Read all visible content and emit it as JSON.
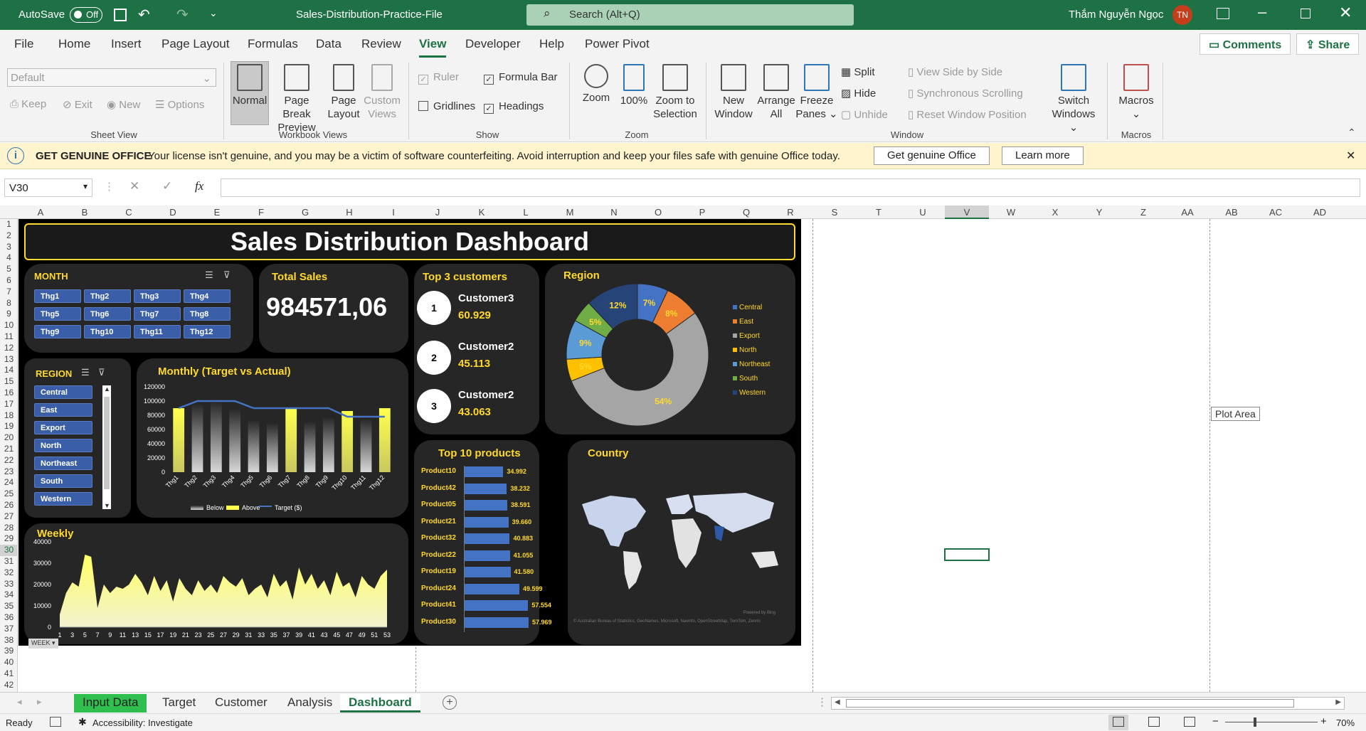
{
  "titlebar": {
    "autosave_label": "AutoSave",
    "autosave_state": "Off",
    "filename": "Sales-Distribution-Practice-File",
    "search_placeholder": "Search (Alt+Q)",
    "user_name": "Thắm Nguyễn Ngọc",
    "user_initials": "TN"
  },
  "ribbon_tabs": [
    "File",
    "Home",
    "Insert",
    "Page Layout",
    "Formulas",
    "Data",
    "Review",
    "View",
    "Developer",
    "Help",
    "Power Pivot"
  ],
  "active_tab": "View",
  "right_buttons": {
    "comments": "Comments",
    "share": "Share"
  },
  "ribbon": {
    "sheet_view": {
      "dropdown": "Default",
      "keep": "Keep",
      "exit": "Exit",
      "new": "New",
      "options": "Options",
      "label": "Sheet View"
    },
    "workbook_views": {
      "normal": "Normal",
      "page_break": "Page Break",
      "page_break2": "Preview",
      "page_layout": "Page",
      "page_layout2": "Layout",
      "custom": "Custom",
      "custom2": "Views",
      "label": "Workbook Views"
    },
    "show": {
      "ruler": "Ruler",
      "formula_bar": "Formula Bar",
      "gridlines": "Gridlines",
      "headings": "Headings",
      "label": "Show"
    },
    "zoom": {
      "zoom": "Zoom",
      "hundred": "100%",
      "zoom_sel": "Zoom to",
      "zoom_sel2": "Selection",
      "label": "Zoom"
    },
    "window": {
      "new_window": "New",
      "new_window2": "Window",
      "arrange": "Arrange",
      "arrange2": "All",
      "freeze": "Freeze",
      "freeze2": "Panes",
      "split": "Split",
      "hide": "Hide",
      "unhide": "Unhide",
      "side": "View Side by Side",
      "sync": "Synchronous Scrolling",
      "reset": "Reset Window Position",
      "switch": "Switch",
      "switch2": "Windows",
      "label": "Window"
    },
    "macros": {
      "macros": "Macros",
      "label": "Macros"
    }
  },
  "message_bar": {
    "title": "GET GENUINE OFFICE",
    "text": "Your license isn't genuine, and you may be a victim of software counterfeiting. Avoid interruption and keep your files safe with genuine Office today.",
    "btn1": "Get genuine Office",
    "btn2": "Learn more"
  },
  "formula_bar": {
    "namebox": "V30",
    "fx": "fx",
    "value": ""
  },
  "columns": [
    "A",
    "B",
    "C",
    "D",
    "E",
    "F",
    "G",
    "H",
    "I",
    "J",
    "K",
    "L",
    "M",
    "N",
    "O",
    "P",
    "Q",
    "R",
    "S",
    "T",
    "U",
    "V",
    "W",
    "X",
    "Y",
    "Z",
    "AA",
    "AB",
    "AC",
    "AD"
  ],
  "rows": [
    "1",
    "2",
    "3",
    "4",
    "5",
    "6",
    "7",
    "8",
    "9",
    "10",
    "11",
    "12",
    "13",
    "14",
    "15",
    "16",
    "17",
    "18",
    "19",
    "20",
    "21",
    "22",
    "23",
    "24",
    "25",
    "26",
    "27",
    "28",
    "29",
    "30",
    "31",
    "32",
    "33",
    "34",
    "35",
    "36",
    "37",
    "38",
    "39",
    "40",
    "41",
    "42"
  ],
  "dashboard": {
    "title": "Sales Distribution Dashboard",
    "month_slicer": {
      "title": "MONTH",
      "items": [
        "Thg1",
        "Thg2",
        "Thg3",
        "Thg4",
        "Thg5",
        "Thg6",
        "Thg7",
        "Thg8",
        "Thg9",
        "Thg10",
        "Thg11",
        "Thg12"
      ]
    },
    "total_sales": {
      "title": "Total Sales",
      "value": "984571,06"
    },
    "top3": {
      "title": "Top 3 customers",
      "items": [
        {
          "rank": "1",
          "name": "Customer3",
          "value": "60.929"
        },
        {
          "rank": "2",
          "name": "Customer2",
          "value": "45.113"
        },
        {
          "rank": "3",
          "name": "Customer2",
          "value": "43.063"
        }
      ]
    },
    "region_slicer": {
      "title": "REGION",
      "items": [
        "Central",
        "East",
        "Export",
        "North",
        "Northeast",
        "South",
        "Western"
      ]
    },
    "week_button": "WEEK",
    "plot_area_tooltip": "Plot Area"
  },
  "chart_data": [
    {
      "type": "donut",
      "title": "Region",
      "labels": [
        "Central",
        "East",
        "Export",
        "North",
        "Northeast",
        "South",
        "Western"
      ],
      "values": [
        7,
        8,
        54,
        5,
        9,
        5,
        12
      ],
      "data_labels": [
        "7%",
        "8%",
        "54%",
        "5%",
        "9%",
        "5%",
        "12%"
      ],
      "colors": [
        "#4472c4",
        "#ed7d31",
        "#a5a5a5",
        "#ffc000",
        "#5b9bd5",
        "#70ad47",
        "#264478"
      ]
    },
    {
      "type": "bar",
      "title": "Monthly (Target vs Actual)",
      "categories": [
        "Thg1",
        "Thg2",
        "Thg3",
        "Thg4",
        "Thg5",
        "Thg6",
        "Thg7",
        "Thg8",
        "Thg9",
        "Thg10",
        "Thg11",
        "Thg12"
      ],
      "series": [
        {
          "name": "Below",
          "values": [
            0,
            95000,
            98000,
            88000,
            72000,
            68000,
            0,
            70000,
            76000,
            0,
            74000,
            0
          ]
        },
        {
          "name": "Above",
          "values": [
            90000,
            0,
            0,
            0,
            0,
            0,
            90000,
            0,
            0,
            86000,
            0,
            90000
          ]
        },
        {
          "name": "Target ($)",
          "values": [
            90000,
            100000,
            100000,
            100000,
            90000,
            90000,
            90000,
            90000,
            90000,
            78000,
            78000,
            78000
          ]
        }
      ],
      "yticks": [
        "120000",
        "100000",
        "80000",
        "60000",
        "40000",
        "20000",
        "0"
      ],
      "ylim": [
        0,
        120000
      ]
    },
    {
      "type": "bar",
      "orientation": "horizontal",
      "title": "Top 10 products",
      "categories": [
        "Product10",
        "Product42",
        "Product05",
        "Product21",
        "Product32",
        "Product22",
        "Product19",
        "Product24",
        "Product41",
        "Product30"
      ],
      "values": [
        34992,
        38232,
        38591,
        39660,
        40883,
        41055,
        41580,
        49599,
        57554,
        57969
      ],
      "data_labels": [
        "34.992",
        "38.232",
        "38.591",
        "39.660",
        "40.883",
        "41.055",
        "41.580",
        "49.599",
        "57.554",
        "57.969"
      ]
    },
    {
      "type": "map",
      "title": "Country",
      "credit1": "Powered by Bing",
      "credit2": "© Australian Bureau of Statistics, GeoNames, Microsoft, Navinfo, OpenStreetMap, TomTom, Zenrin"
    },
    {
      "type": "area",
      "title": "Weekly",
      "x": [
        1,
        2,
        3,
        4,
        5,
        6,
        7,
        8,
        9,
        10,
        11,
        12,
        13,
        14,
        15,
        16,
        17,
        18,
        19,
        20,
        21,
        22,
        23,
        24,
        25,
        26,
        27,
        28,
        29,
        30,
        31,
        32,
        33,
        34,
        35,
        36,
        37,
        38,
        39,
        40,
        41,
        42,
        43,
        44,
        45,
        46,
        47,
        48,
        49,
        50,
        51,
        52,
        53
      ],
      "values": [
        6000,
        16000,
        21000,
        19000,
        34000,
        33000,
        9000,
        20000,
        16000,
        19000,
        18000,
        20000,
        25000,
        21000,
        15000,
        24000,
        17000,
        22000,
        12000,
        23000,
        18000,
        15000,
        22000,
        17000,
        20000,
        16000,
        24000,
        21000,
        19000,
        23000,
        15000,
        18000,
        20000,
        14000,
        25000,
        19000,
        22000,
        13000,
        28000,
        20000,
        25000,
        18000,
        22000,
        15000,
        26000,
        19000,
        21000,
        14000,
        24000,
        20000,
        18000,
        24000,
        27000
      ],
      "xticks": [
        "1",
        "3",
        "5",
        "7",
        "9",
        "11",
        "13",
        "15",
        "17",
        "19",
        "21",
        "23",
        "25",
        "27",
        "29",
        "31",
        "33",
        "35",
        "37",
        "39",
        "41",
        "43",
        "45",
        "47",
        "49",
        "51",
        "53"
      ],
      "yticks": [
        "40000",
        "30000",
        "20000",
        "10000",
        "0"
      ],
      "ylim": [
        0,
        40000
      ]
    }
  ],
  "sheet_tabs": [
    "Input Data",
    "Target",
    "Customer",
    "Analysis",
    "Dashboard"
  ],
  "active_sheet": "Dashboard",
  "statusbar": {
    "ready": "Ready",
    "accessibility": "Accessibility: Investigate",
    "zoom": "70%"
  }
}
